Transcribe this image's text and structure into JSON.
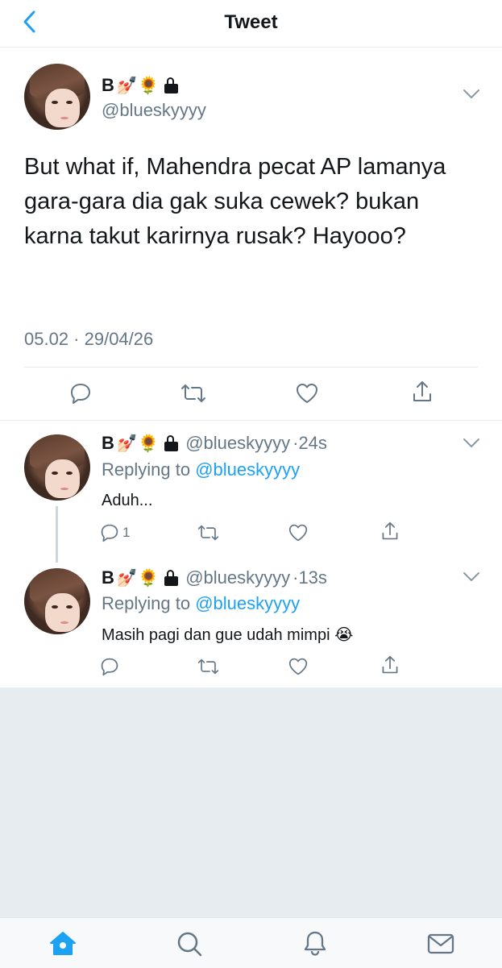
{
  "header": {
    "title": "Tweet"
  },
  "main_tweet": {
    "name": "B",
    "name_emojis": "💅🏻🌻",
    "handle": "@blueskyyyy",
    "text": "But what if, Mahendra pecat AP lamanya gara-gara dia gak suka cewek? bukan karna takut karirnya rusak? Hayooo?",
    "timestamp": "05.02 · 29/04/26"
  },
  "replies": [
    {
      "name": "B",
      "name_emojis": "💅🏻🌻",
      "handle": "@blueskyyyy",
      "age": "·24s",
      "replying_prefix": "Replying to ",
      "replying_to": "@blueskyyyy",
      "text": "Aduh...",
      "reply_count": "1"
    },
    {
      "name": "B",
      "name_emojis": "💅🏻🌻",
      "handle": "@blueskyyyy",
      "age": "·13s",
      "replying_prefix": "Replying to ",
      "replying_to": "@blueskyyyy",
      "text": "Masih pagi dan gue udah mimpi 😭",
      "reply_count": ""
    }
  ],
  "colors": {
    "accent": "#1da1f2",
    "secondary_text": "#657786",
    "divider": "#e6ecf0"
  },
  "tabbar": {
    "icons": [
      "home-icon",
      "search-icon",
      "notifications-icon",
      "messages-icon"
    ]
  }
}
